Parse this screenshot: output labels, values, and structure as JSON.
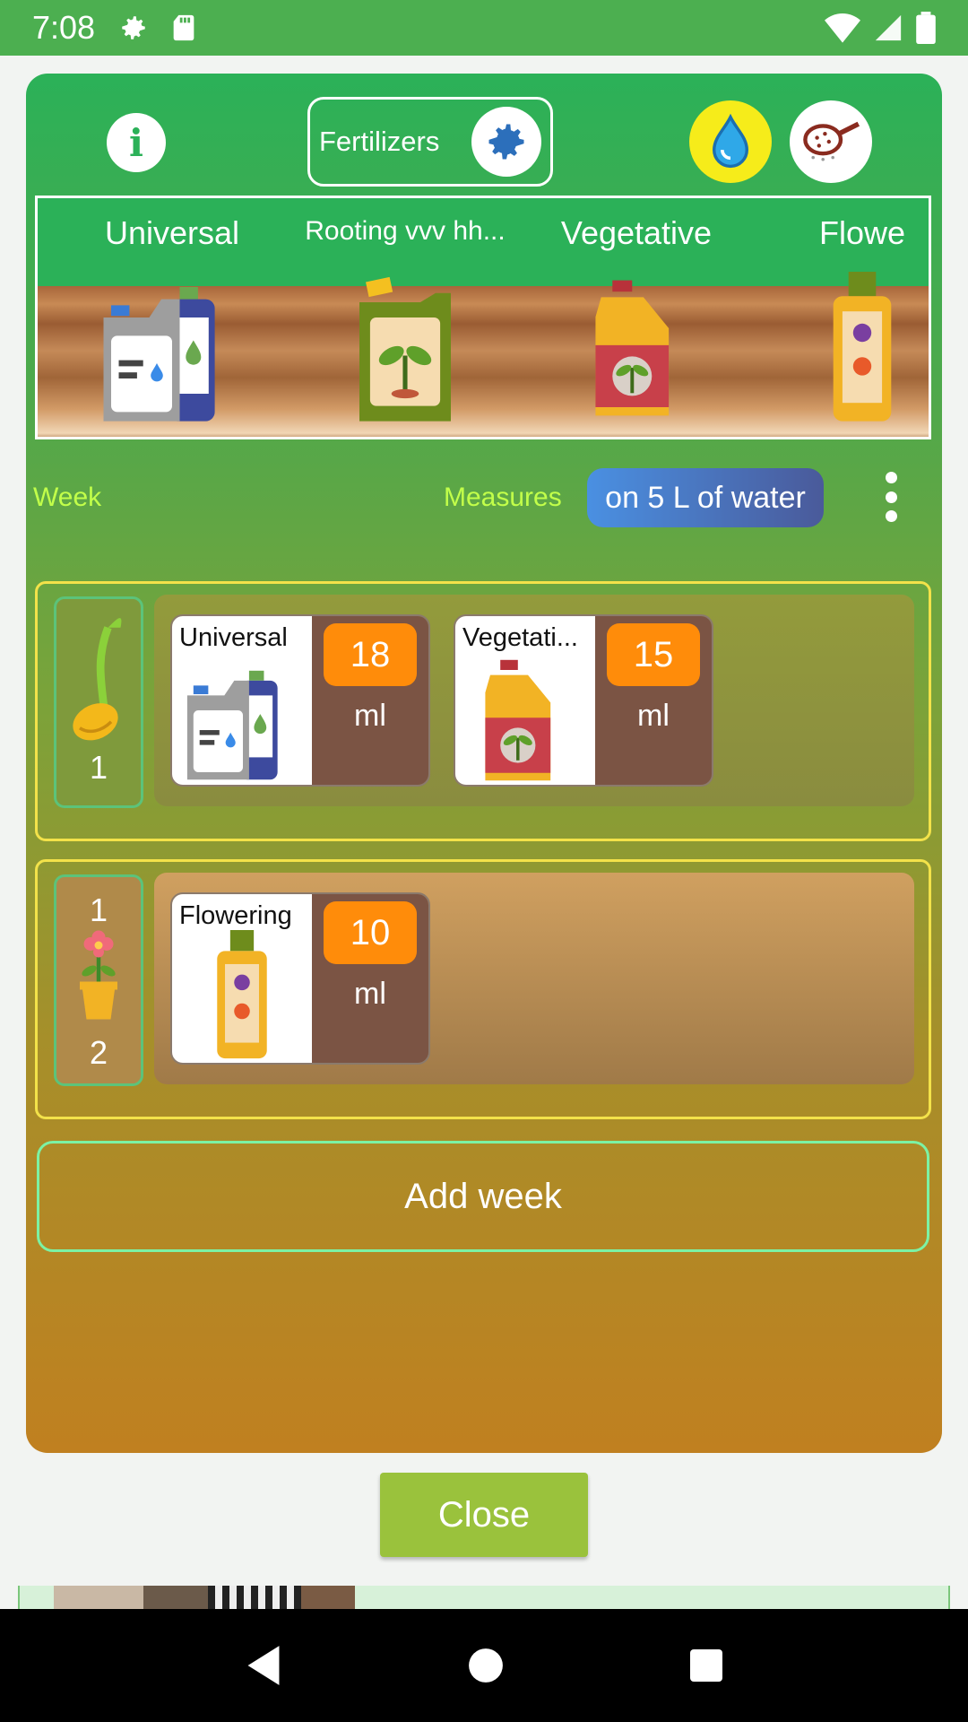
{
  "status_bar": {
    "time": "7:08"
  },
  "header": {
    "fertilizers_label": "Fertilizers"
  },
  "shelf": {
    "items": [
      {
        "label": "Universal"
      },
      {
        "label": "Rooting vvv hh..."
      },
      {
        "label": "Vegetative"
      },
      {
        "label": "Flowe"
      }
    ]
  },
  "controls": {
    "week_label": "Week",
    "measures_label": "Measures",
    "measures_value": "on 5 L of water"
  },
  "weeks": [
    {
      "badge_top": "",
      "badge_bottom": "1",
      "items": [
        {
          "name": "Universal",
          "amount": "18",
          "unit": "ml"
        },
        {
          "name": "Vegetati...",
          "amount": "15",
          "unit": "ml"
        }
      ]
    },
    {
      "badge_top": "1",
      "badge_bottom": "2",
      "items": [
        {
          "name": "Flowering",
          "amount": "10",
          "unit": "ml"
        }
      ]
    }
  ],
  "add_week_label": "Add week",
  "close_label": "Close"
}
